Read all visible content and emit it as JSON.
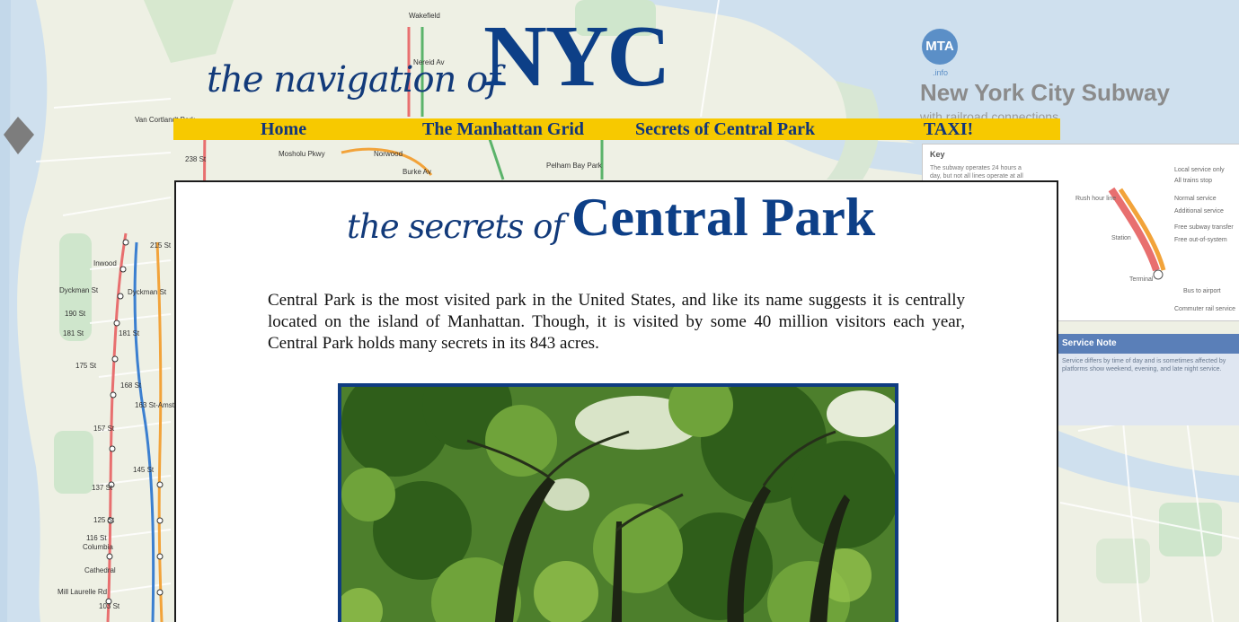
{
  "header": {
    "title_script": "the navigation of",
    "title_big": "NYC"
  },
  "nav": {
    "items": [
      {
        "label": "Home"
      },
      {
        "label": "The Manhattan Grid"
      },
      {
        "label": "Secrets of Central Park"
      },
      {
        "label": "TAXI!"
      }
    ]
  },
  "map_decor": {
    "mta_logo": "MTA",
    "mta_sub": ".info",
    "subway_title": "New York City Subway",
    "subway_subtitle": "with railroad connections",
    "key_title": "Key",
    "key_text": "The subway operates 24 hours a day, but not all lines operate at all",
    "service_note_title": "Service Note",
    "service_note_body": "Service differs by time of day and is sometimes affected by platforms show weekend, evening, and late night service.",
    "station_labels": [
      "Wakefield 241 St",
      "Nereid Av",
      "Van Cortlandt Park 242 St",
      "238 St",
      "Mosholu Pkwy",
      "Norwood 205 St",
      "Burke Av",
      "Pelham Bay Park",
      "215 St",
      "207 St",
      "Dyckman St",
      "190 St",
      "181 St",
      "175 St",
      "168 St",
      "163 St-Amsterdam Av",
      "157 St",
      "145 St",
      "137 St City College",
      "125 St",
      "116 St Columbia University",
      "Cathedral Pkwy (110 St)",
      "103 St",
      "Inwood 207 St",
      "Mill Laurelle Rd"
    ]
  },
  "main": {
    "heading_script": "the secrets of",
    "heading_big": "Central Park",
    "intro": "Central Park is the most visited park in the United States, and like its name suggests it is centrally located on the island of Manhattan. Though, it is visited by some 40 million visitors each year, Central Park holds many secrets in its 843 acres."
  },
  "colors": {
    "brand_blue": "#0d3f87",
    "nav_yellow": "#f7c900",
    "map_water": "#cfe0ee",
    "map_land": "#eef0e4"
  }
}
